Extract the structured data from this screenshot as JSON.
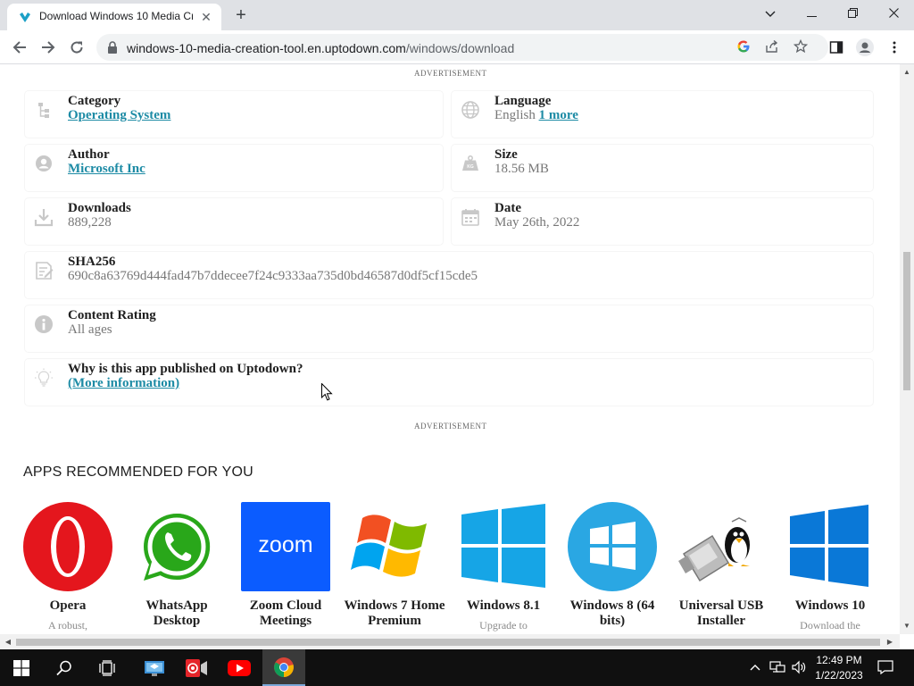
{
  "browser": {
    "tab_title": "Download Windows 10 Media Cr",
    "tab_close": "✕",
    "new_tab": "+",
    "url_host": "windows-10-media-creation-tool.en.uptodown.com",
    "url_path": "/windows/download",
    "window_minimize": "—",
    "window_restore": "❐",
    "window_close": "✕",
    "tab_dropdown": "⌄",
    "accent_color": "#1a73e8"
  },
  "page": {
    "ad_label_top": "ADVERTISEMENT",
    "ad_label_bottom": "ADVERTISEMENT",
    "link_color": "#1d8ba5",
    "info": {
      "category": {
        "label": "Category",
        "value": "Operating System"
      },
      "language": {
        "label": "Language",
        "value": "English",
        "more": "1 more"
      },
      "author": {
        "label": "Author",
        "value": "Microsoft Inc"
      },
      "size": {
        "label": "Size",
        "value": "18.56 MB"
      },
      "downloads": {
        "label": "Downloads",
        "value": "889,228"
      },
      "date": {
        "label": "Date",
        "value": "May 26th, 2022"
      },
      "sha256": {
        "label": "SHA256",
        "value": "690c8a63769d444fad47b7ddecee7f24c9333aa735d0bd46587d0df5cf15cde5"
      },
      "content_rating": {
        "label": "Content Rating",
        "value": "All ages"
      },
      "why": {
        "label": "Why is this app published on Uptodown?",
        "value": "(More information)"
      }
    },
    "recommended_title": "APPS RECOMMENDED FOR YOU",
    "apps": [
      {
        "name": "Opera",
        "desc": "A robust,"
      },
      {
        "name": "WhatsApp Desktop",
        "desc": ""
      },
      {
        "name": "Zoom Cloud Meetings",
        "desc": "",
        "icon_text": "zoom"
      },
      {
        "name": "Windows 7 Home Premium",
        "desc": ""
      },
      {
        "name": "Windows 8.1",
        "desc": "Upgrade to"
      },
      {
        "name": "Windows 8 (64 bits)",
        "desc": ""
      },
      {
        "name": "Universal USB Installer",
        "desc": ""
      },
      {
        "name": "Windows 10",
        "desc": "Download the"
      }
    ]
  },
  "taskbar": {
    "time": "12:49 PM",
    "date": "1/22/2023"
  }
}
